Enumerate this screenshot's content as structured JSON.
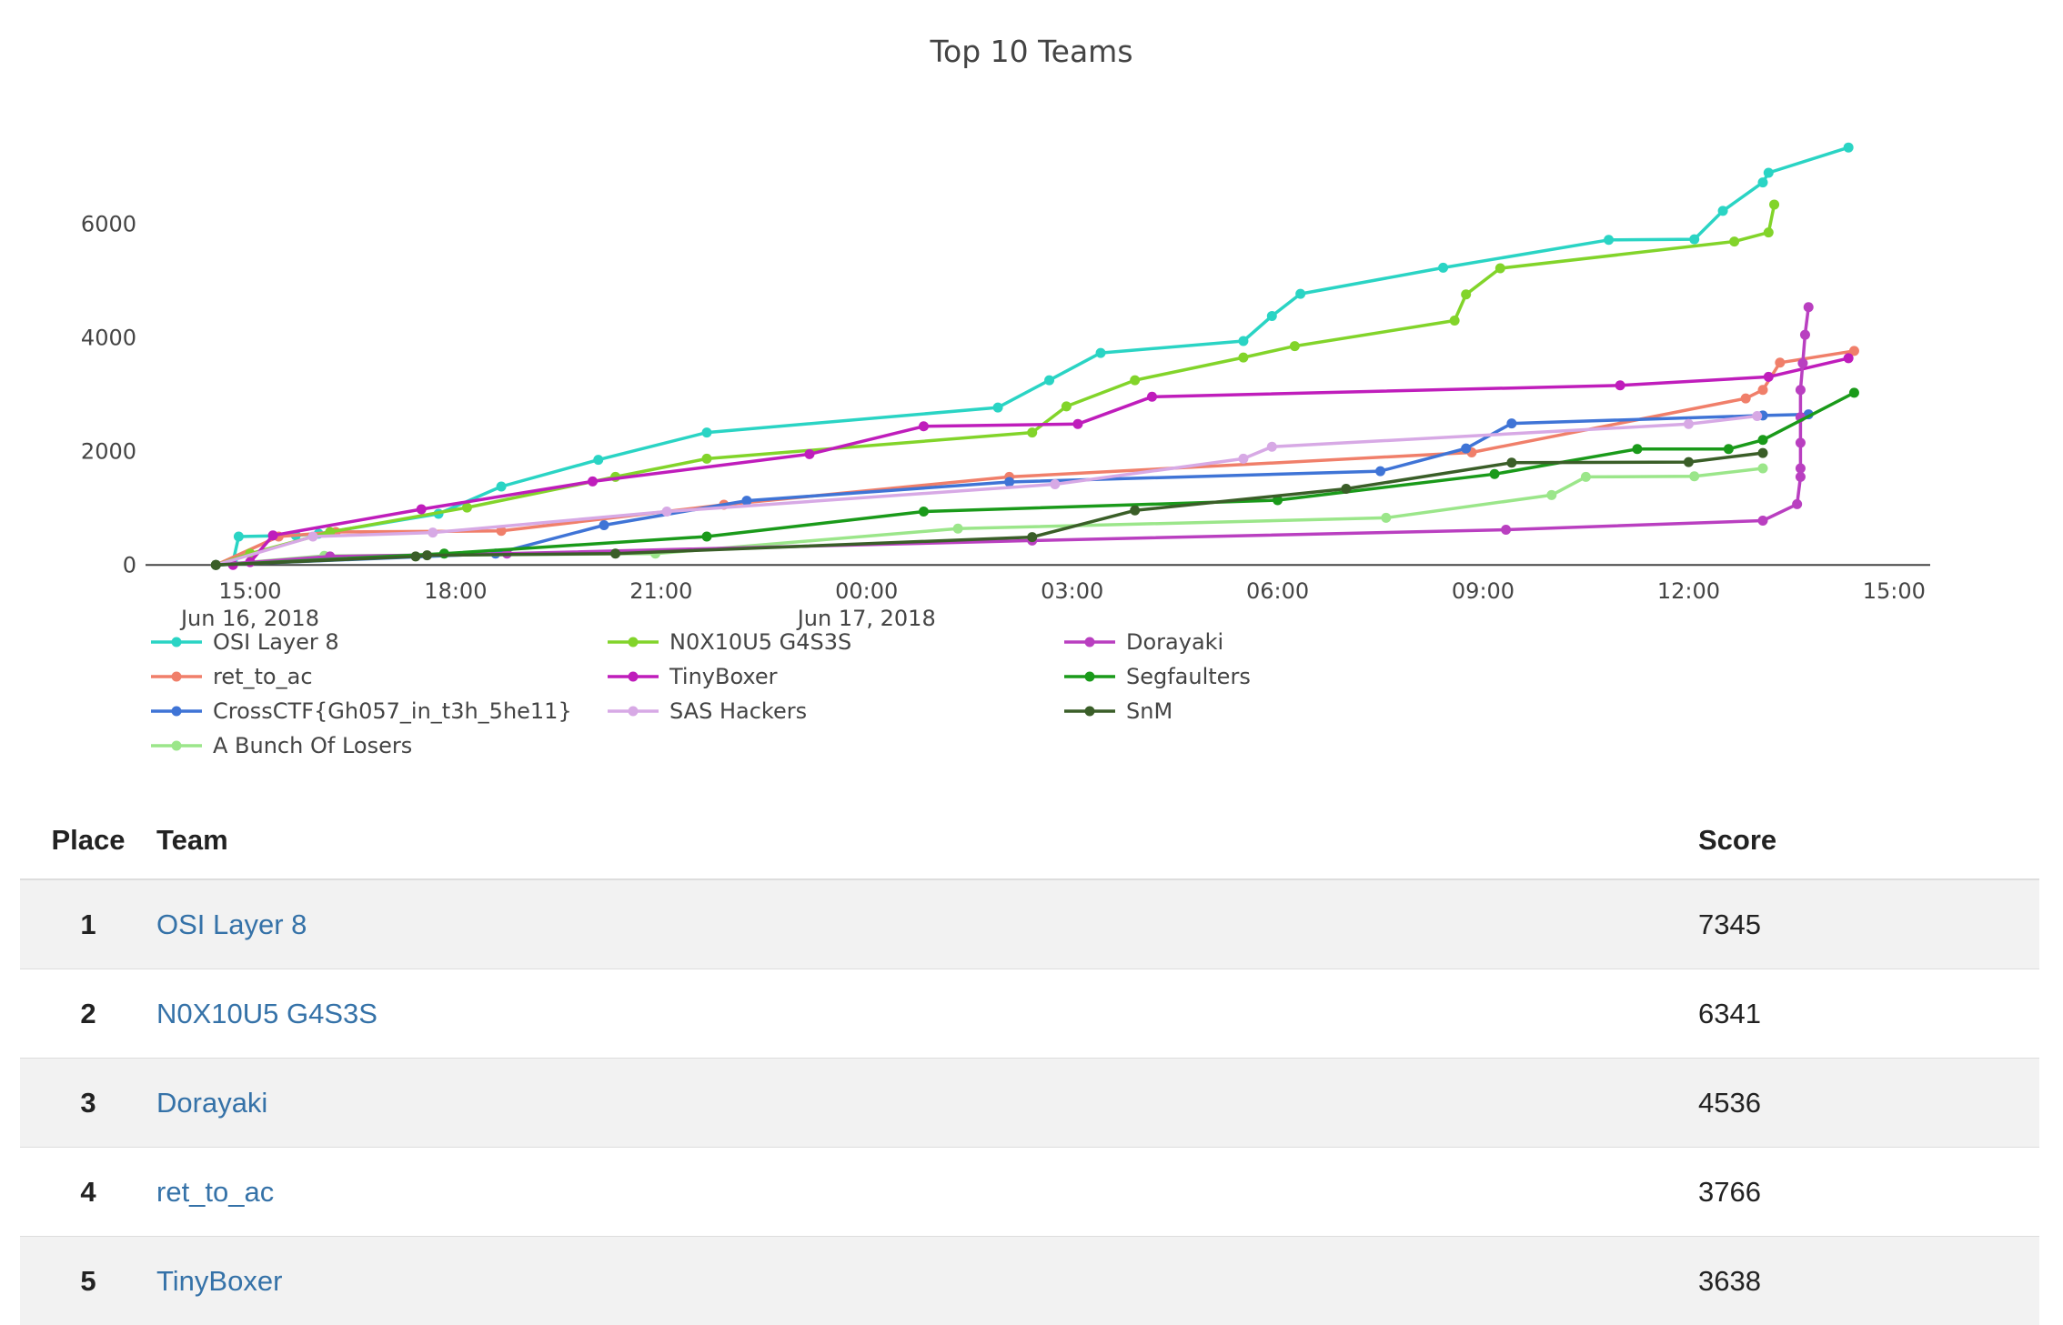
{
  "chart_data": {
    "type": "line",
    "title": "Top 10 Teams",
    "xlabel": "",
    "ylabel": "",
    "xlim": [
      "2018-06-16T13:30",
      "2018-06-17T15:30"
    ],
    "ylim": [
      -300,
      7700
    ],
    "x_ticks": [
      {
        "t": "2018-06-16T15:00",
        "line1": "15:00",
        "line2": "Jun 16, 2018"
      },
      {
        "t": "2018-06-16T18:00",
        "line1": "18:00",
        "line2": ""
      },
      {
        "t": "2018-06-16T21:00",
        "line1": "21:00",
        "line2": ""
      },
      {
        "t": "2018-06-17T00:00",
        "line1": "00:00",
        "line2": "Jun 17, 2018"
      },
      {
        "t": "2018-06-17T03:00",
        "line1": "03:00",
        "line2": ""
      },
      {
        "t": "2018-06-17T06:00",
        "line1": "06:00",
        "line2": ""
      },
      {
        "t": "2018-06-17T09:00",
        "line1": "09:00",
        "line2": ""
      },
      {
        "t": "2018-06-17T12:00",
        "line1": "12:00",
        "line2": ""
      },
      {
        "t": "2018-06-17T15:00",
        "line1": "15:00",
        "line2": ""
      }
    ],
    "y_ticks": [
      0,
      2000,
      4000,
      6000
    ],
    "legend_position": "bottom-left",
    "series": [
      {
        "name": "OSI Layer 8",
        "color": "#2ad4c4",
        "points": [
          [
            "2018-06-16T14:30",
            0
          ],
          [
            "2018-06-16T14:45",
            50
          ],
          [
            "2018-06-16T14:50",
            500
          ],
          [
            "2018-06-16T15:40",
            520
          ],
          [
            "2018-06-16T16:00",
            550
          ],
          [
            "2018-06-16T17:45",
            900
          ],
          [
            "2018-06-16T18:40",
            1380
          ],
          [
            "2018-06-16T20:05",
            1850
          ],
          [
            "2018-06-16T21:40",
            2330
          ],
          [
            "2018-06-17T01:55",
            2770
          ],
          [
            "2018-06-17T02:40",
            3250
          ],
          [
            "2018-06-17T03:25",
            3730
          ],
          [
            "2018-06-17T05:30",
            3940
          ],
          [
            "2018-06-17T05:55",
            4380
          ],
          [
            "2018-06-17T06:20",
            4770
          ],
          [
            "2018-06-17T08:25",
            5230
          ],
          [
            "2018-06-17T10:50",
            5720
          ],
          [
            "2018-06-17T12:05",
            5730
          ],
          [
            "2018-06-17T12:30",
            6230
          ],
          [
            "2018-06-17T13:05",
            6730
          ],
          [
            "2018-06-17T13:10",
            6900
          ],
          [
            "2018-06-17T14:20",
            7345
          ]
        ]
      },
      {
        "name": "ret_to_ac",
        "color": "#f07f6a",
        "points": [
          [
            "2018-06-16T14:30",
            0
          ],
          [
            "2018-06-16T15:25",
            500
          ],
          [
            "2018-06-16T16:15",
            580
          ],
          [
            "2018-06-16T18:40",
            600
          ],
          [
            "2018-06-16T21:55",
            1060
          ],
          [
            "2018-06-17T02:05",
            1550
          ],
          [
            "2018-06-17T08:50",
            1980
          ],
          [
            "2018-06-17T12:50",
            2930
          ],
          [
            "2018-06-17T13:05",
            3080
          ],
          [
            "2018-06-17T13:20",
            3560
          ],
          [
            "2018-06-17T14:25",
            3766
          ]
        ]
      },
      {
        "name": "CrossCTF{Gh057_in_t3h_5he11}",
        "color": "#3f74d6",
        "points": [
          [
            "2018-06-16T14:30",
            0
          ],
          [
            "2018-06-16T18:35",
            200
          ],
          [
            "2018-06-16T20:10",
            700
          ],
          [
            "2018-06-16T22:15",
            1130
          ],
          [
            "2018-06-17T02:05",
            1460
          ],
          [
            "2018-06-17T07:30",
            1650
          ],
          [
            "2018-06-17T08:45",
            2050
          ],
          [
            "2018-06-17T09:25",
            2490
          ],
          [
            "2018-06-17T13:05",
            2630
          ],
          [
            "2018-06-17T13:45",
            2650
          ]
        ]
      },
      {
        "name": "A Bunch Of Losers",
        "color": "#9be68a",
        "points": [
          [
            "2018-06-16T14:30",
            0
          ],
          [
            "2018-06-16T16:05",
            160
          ],
          [
            "2018-06-16T20:55",
            200
          ],
          [
            "2018-06-17T01:20",
            640
          ],
          [
            "2018-06-17T07:35",
            830
          ],
          [
            "2018-06-17T10:00",
            1230
          ],
          [
            "2018-06-17T10:30",
            1550
          ],
          [
            "2018-06-17T12:05",
            1560
          ],
          [
            "2018-06-17T13:05",
            1700
          ]
        ]
      },
      {
        "name": "N0X10U5 G4S3S",
        "color": "#82d42a",
        "points": [
          [
            "2018-06-16T14:30",
            0
          ],
          [
            "2018-06-16T15:00",
            200
          ],
          [
            "2018-06-16T16:10",
            580
          ],
          [
            "2018-06-16T18:10",
            1010
          ],
          [
            "2018-06-16T20:20",
            1550
          ],
          [
            "2018-06-16T21:40",
            1870
          ],
          [
            "2018-06-17T02:25",
            2330
          ],
          [
            "2018-06-17T02:55",
            2790
          ],
          [
            "2018-06-17T03:55",
            3250
          ],
          [
            "2018-06-17T05:30",
            3650
          ],
          [
            "2018-06-17T06:15",
            3850
          ],
          [
            "2018-06-17T08:35",
            4300
          ],
          [
            "2018-06-17T08:45",
            4760
          ],
          [
            "2018-06-17T09:15",
            5220
          ],
          [
            "2018-06-17T12:40",
            5690
          ],
          [
            "2018-06-17T13:10",
            5850
          ],
          [
            "2018-06-17T13:15",
            6341
          ]
        ]
      },
      {
        "name": "TinyBoxer",
        "color": "#bf1dbb",
        "points": [
          [
            "2018-06-16T14:45",
            0
          ],
          [
            "2018-06-16T15:00",
            50
          ],
          [
            "2018-06-16T15:20",
            520
          ],
          [
            "2018-06-16T17:30",
            980
          ],
          [
            "2018-06-16T20:00",
            1470
          ],
          [
            "2018-06-16T23:10",
            1950
          ],
          [
            "2018-06-17T00:50",
            2440
          ],
          [
            "2018-06-17T03:05",
            2480
          ],
          [
            "2018-06-17T04:10",
            2960
          ],
          [
            "2018-06-17T11:00",
            3160
          ],
          [
            "2018-06-17T13:10",
            3310
          ],
          [
            "2018-06-17T14:20",
            3638
          ]
        ]
      },
      {
        "name": "SAS Hackers",
        "color": "#d7a9e5",
        "points": [
          [
            "2018-06-16T14:30",
            0
          ],
          [
            "2018-06-16T15:55",
            500
          ],
          [
            "2018-06-16T17:40",
            570
          ],
          [
            "2018-06-16T21:05",
            940
          ],
          [
            "2018-06-17T02:45",
            1420
          ],
          [
            "2018-06-17T05:30",
            1870
          ],
          [
            "2018-06-17T05:55",
            2080
          ],
          [
            "2018-06-17T12:00",
            2480
          ],
          [
            "2018-06-17T13:00",
            2620
          ]
        ]
      },
      {
        "name": "Dorayaki",
        "color": "#b93fc0",
        "points": [
          [
            "2018-06-16T14:30",
            0
          ],
          [
            "2018-06-16T16:10",
            150
          ],
          [
            "2018-06-16T18:45",
            200
          ],
          [
            "2018-06-17T02:25",
            430
          ],
          [
            "2018-06-17T09:20",
            620
          ],
          [
            "2018-06-17T13:05",
            780
          ],
          [
            "2018-06-17T13:35",
            1070
          ],
          [
            "2018-06-17T13:38",
            1550
          ],
          [
            "2018-06-17T13:38",
            1700
          ],
          [
            "2018-06-17T13:38",
            2150
          ],
          [
            "2018-06-17T13:38",
            2600
          ],
          [
            "2018-06-17T13:38",
            3080
          ],
          [
            "2018-06-17T13:40",
            3550
          ],
          [
            "2018-06-17T13:42",
            4050
          ],
          [
            "2018-06-17T13:45",
            4536
          ]
        ]
      },
      {
        "name": "Segfaulters",
        "color": "#1a9a1a",
        "points": [
          [
            "2018-06-16T14:30",
            0
          ],
          [
            "2018-06-16T17:50",
            200
          ],
          [
            "2018-06-16T21:40",
            500
          ],
          [
            "2018-06-17T00:50",
            940
          ],
          [
            "2018-06-17T06:00",
            1140
          ],
          [
            "2018-06-17T09:10",
            1600
          ],
          [
            "2018-06-17T11:15",
            2040
          ],
          [
            "2018-06-17T12:35",
            2040
          ],
          [
            "2018-06-17T13:05",
            2200
          ],
          [
            "2018-06-17T14:25",
            3030
          ]
        ]
      },
      {
        "name": "SnM",
        "color": "#3a5e28",
        "points": [
          [
            "2018-06-16T14:30",
            0
          ],
          [
            "2018-06-16T17:25",
            150
          ],
          [
            "2018-06-16T17:35",
            170
          ],
          [
            "2018-06-16T20:20",
            200
          ],
          [
            "2018-06-17T02:25",
            490
          ],
          [
            "2018-06-17T03:55",
            960
          ],
          [
            "2018-06-17T07:00",
            1340
          ],
          [
            "2018-06-17T09:25",
            1800
          ],
          [
            "2018-06-17T12:00",
            1810
          ],
          [
            "2018-06-17T13:05",
            1970
          ]
        ]
      }
    ]
  },
  "legend_columns": [
    [
      "OSI Layer 8",
      "ret_to_ac",
      "CrossCTF{Gh057_in_t3h_5he11}",
      "A Bunch Of Losers"
    ],
    [
      "N0X10U5 G4S3S",
      "TinyBoxer",
      "SAS Hackers"
    ],
    [
      "Dorayaki",
      "Segfaulters",
      "SnM"
    ]
  ],
  "scoreboard": {
    "headers": {
      "place": "Place",
      "team": "Team",
      "score": "Score"
    },
    "rows": [
      {
        "place": "1",
        "team": "OSI Layer 8",
        "score": "7345"
      },
      {
        "place": "2",
        "team": "N0X10U5 G4S3S",
        "score": "6341"
      },
      {
        "place": "3",
        "team": "Dorayaki",
        "score": "4536"
      },
      {
        "place": "4",
        "team": "ret_to_ac",
        "score": "3766"
      },
      {
        "place": "5",
        "team": "TinyBoxer",
        "score": "3638"
      }
    ]
  }
}
